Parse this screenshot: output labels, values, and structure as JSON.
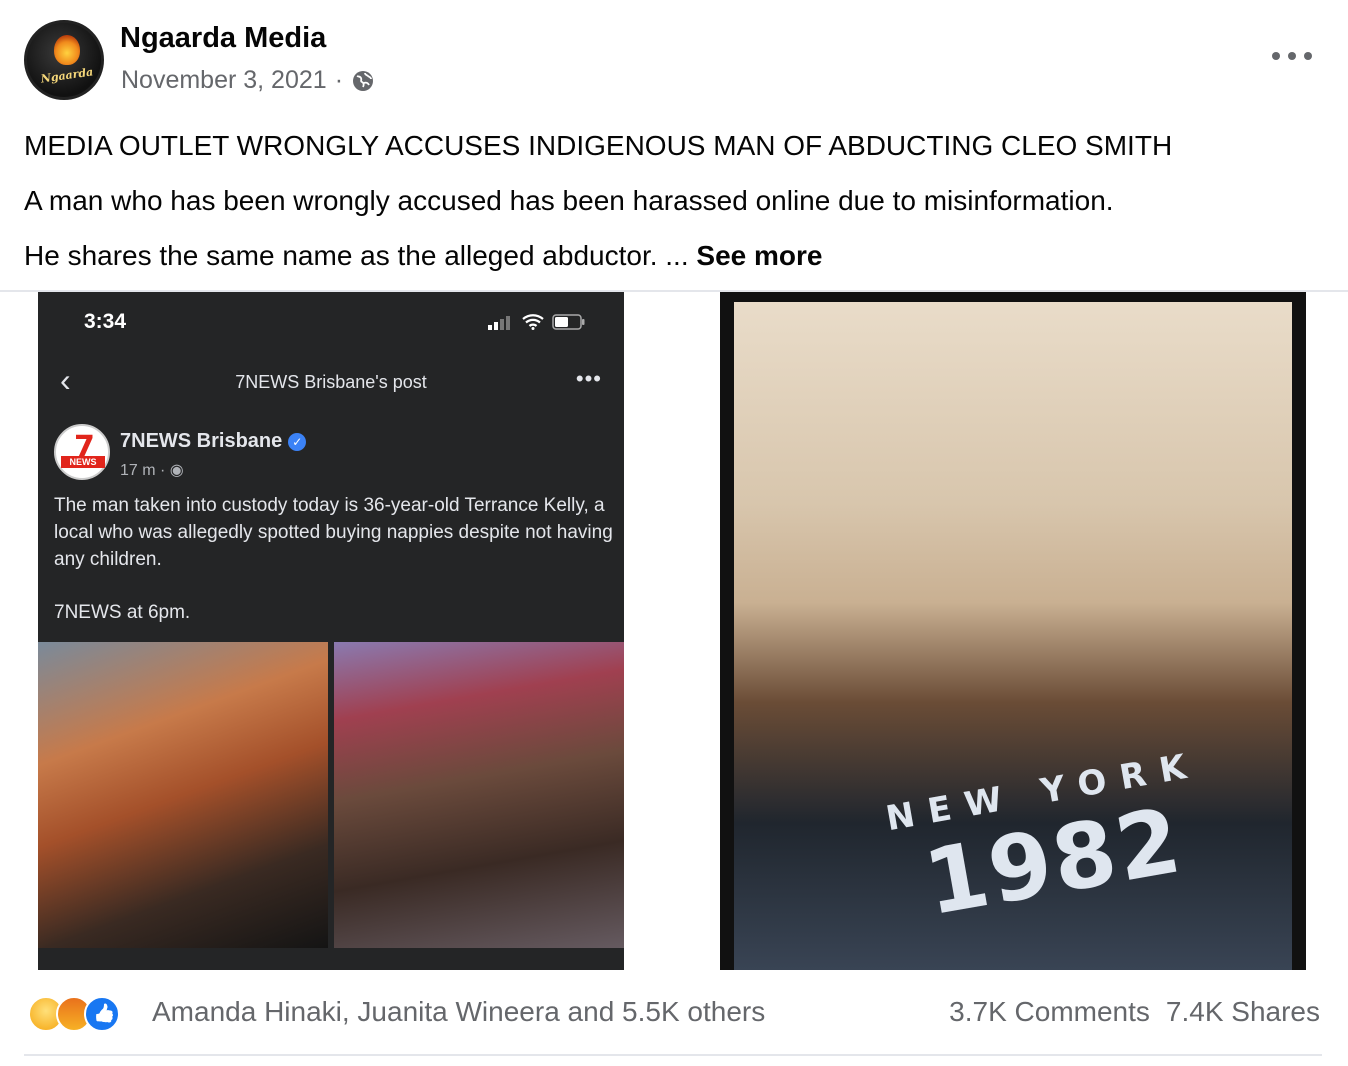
{
  "post": {
    "page_name": "Ngaarda Media",
    "date": "November 3, 2021",
    "separator": "·",
    "avatar_logo_text": "Ngaarda",
    "privacy_icon": "globe-icon",
    "more_icon": "more-options-icon",
    "headline": "MEDIA OUTLET WRONGLY ACCUSES INDIGENOUS MAN OF ABDUCTING CLEO SMITH",
    "line1": "A man who has been wrongly accused has been harassed online due to misinformation.",
    "line2": "He shares the same name as the alleged abductor. ...",
    "see_more": "See more"
  },
  "screenshot": {
    "time": "3:34",
    "nav_title": "7NEWS Brisbane's post",
    "news_name": "7NEWS Brisbane",
    "news_time": "17 m ·",
    "logo_number": "7",
    "logo_text": "NEWS",
    "body": "The man taken into custody today is 36-year-old Terrance Kelly, a local who was allegedly spotted buying nappies despite not having any children.",
    "footer": "7NEWS at 6pm."
  },
  "right_photo": {
    "shirt_line1": "NEW YORK",
    "shirt_line2": "1982"
  },
  "reactions": {
    "icons": [
      "sad-icon",
      "angry-icon",
      "like-icon"
    ],
    "names": "Amanda Hinaki, Juanita Wineera and 5.5K others",
    "comments": "3.7K Comments",
    "shares": "7.4K Shares"
  }
}
